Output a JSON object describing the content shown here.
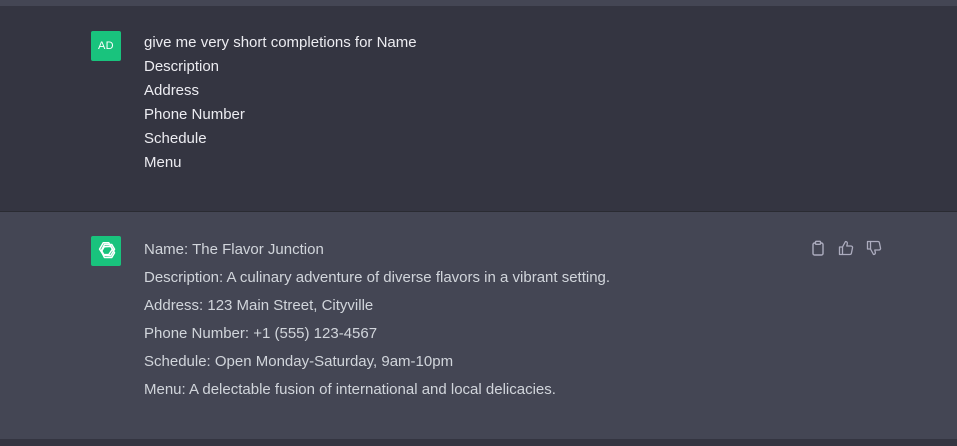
{
  "conversation": {
    "user": {
      "avatar_initials": "AD",
      "lines": [
        "give me very short completions for Name",
        "Description",
        "Address",
        "Phone Number",
        "Schedule",
        "Menu"
      ]
    },
    "assistant": {
      "avatar_icon": "openai-logo-icon",
      "lines": [
        "Name: The Flavor Junction",
        "Description: A culinary adventure of diverse flavors in a vibrant setting.",
        "Address: 123 Main Street, Cityville",
        "Phone Number: +1 (555) 123-4567",
        "Schedule: Open Monday-Saturday, 9am-10pm",
        "Menu: A delectable fusion of international and local delicacies."
      ]
    }
  },
  "actions": {
    "copy_icon": "clipboard-icon",
    "like_icon": "thumbs-up-icon",
    "dislike_icon": "thumbs-down-icon"
  },
  "colors": {
    "user_bg": "#343541",
    "assistant_bg": "#444654",
    "avatar_green": "#19c37d",
    "text": "#ececf1"
  }
}
